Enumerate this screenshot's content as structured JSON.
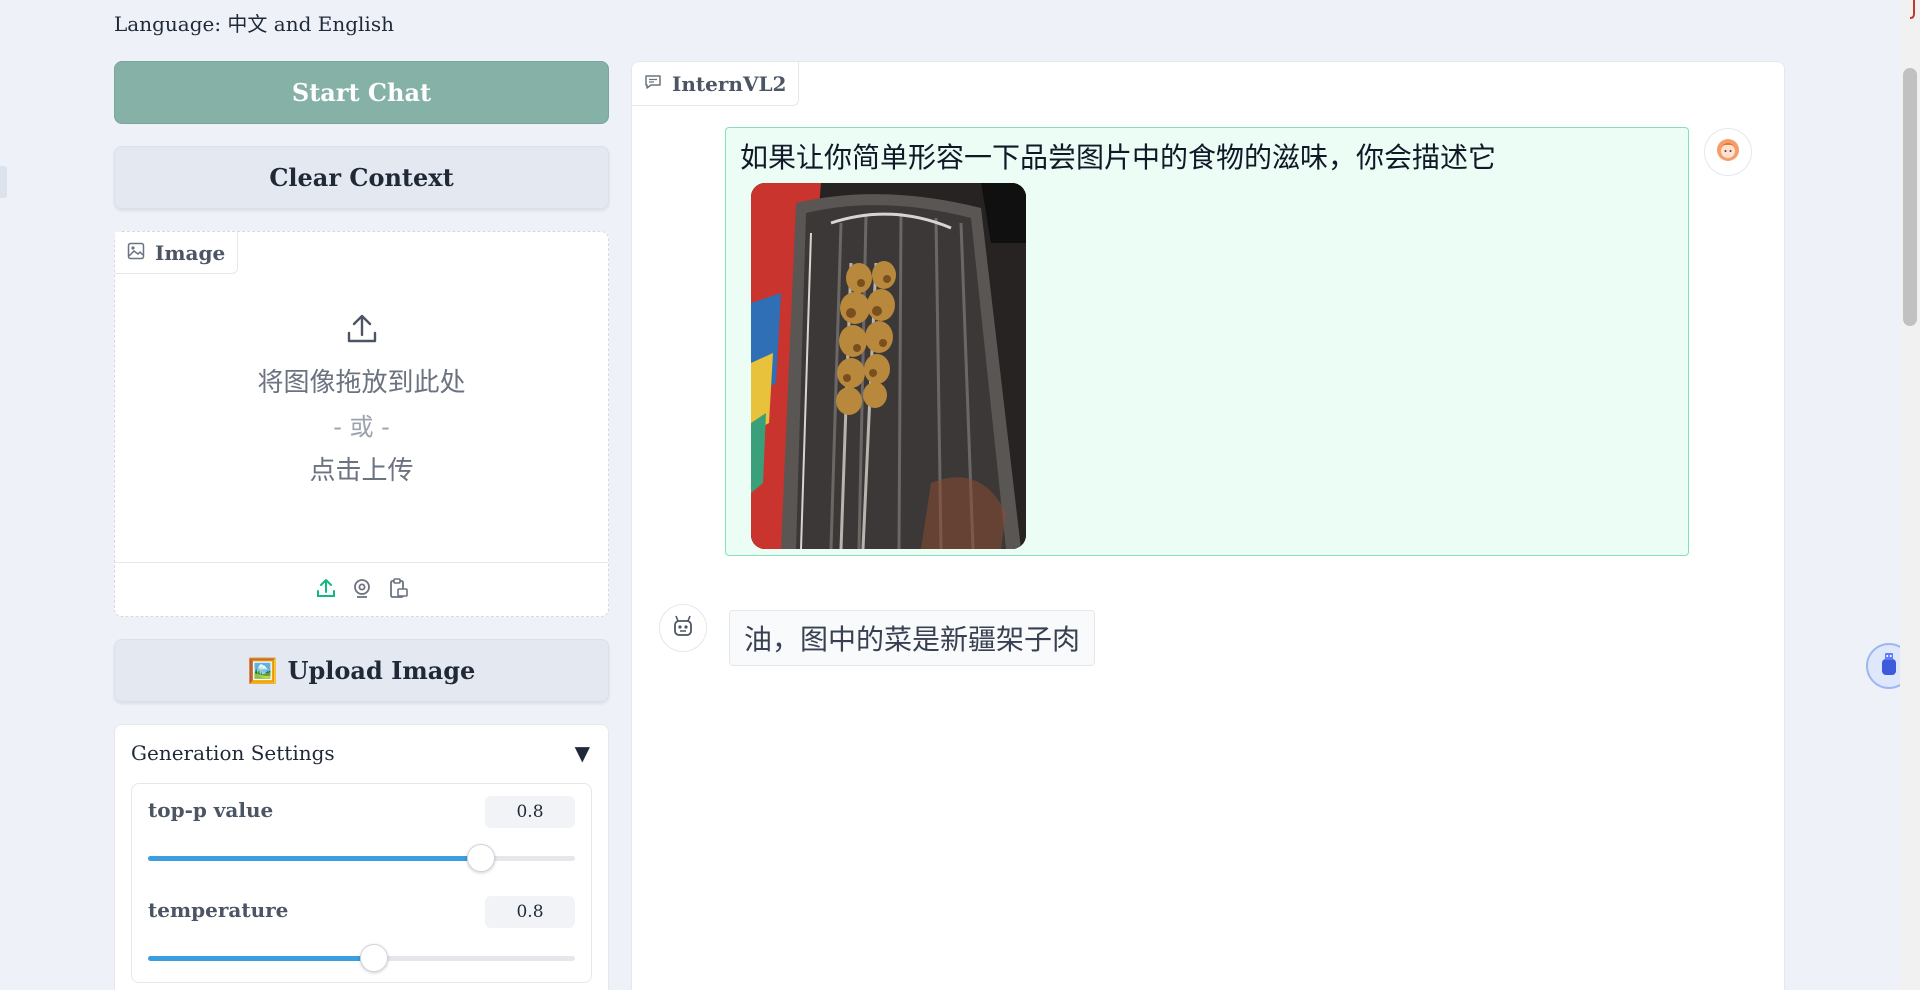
{
  "header": {
    "language_line": "Language: 中文 and English"
  },
  "left_panel": {
    "start_chat_label": "Start Chat",
    "clear_context_label": "Clear Context",
    "image_box": {
      "label": "Image",
      "drop_text": "将图像拖放到此处",
      "or_text": "- 或 -",
      "click_text": "点击上传",
      "sources": [
        "upload-icon",
        "webcam-icon",
        "clipboard-icon"
      ]
    },
    "upload_image_label": "Upload Image",
    "upload_image_emoji": "🖼️",
    "generation_settings": {
      "title": "Generation Settings",
      "toggle_glyph": "▼",
      "sliders": [
        {
          "label": "top-p value",
          "value": "0.8",
          "fraction": 0.78
        },
        {
          "label": "temperature",
          "value": "0.8",
          "fraction": 0.53
        }
      ]
    }
  },
  "chat": {
    "label": "InternVL2",
    "user_message": "如果让你简单形容一下品尝图片中的食物的滋味，你会描述它",
    "bot_message": "油，图中的菜是新疆架子肉"
  },
  "colors": {
    "primary_button": "#86b1a6",
    "user_bubble_bg": "#ecfdf5",
    "user_bubble_border": "#86e0b5",
    "slider_fill": "#3b9ee0",
    "upload_source_accent": "#10b981"
  }
}
